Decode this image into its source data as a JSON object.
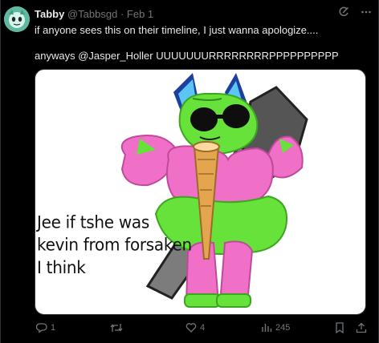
{
  "post": {
    "display_name": "Tabby",
    "handle": "@Tabbsgd",
    "separator": "·",
    "date": "Feb 1",
    "text_line1": "if anyone sees this on their timeline, I just wanna apologize....",
    "text_line2": "anyways @Jasper_Holler UUUUUUURRRRRRRRPPPPPPPPPP"
  },
  "media": {
    "caption_lines": [
      "Jee if tshe was",
      "kevin from forsaken",
      "I think"
    ]
  },
  "actions": {
    "reply_count": "1",
    "retweet_count": "",
    "like_count": "4",
    "views_count": "245"
  },
  "icons": {
    "grok": "grok-icon",
    "more": "more-icon",
    "reply": "reply-icon",
    "retweet": "retweet-icon",
    "like": "like-icon",
    "views": "views-icon",
    "bookmark": "bookmark-icon",
    "share": "share-icon"
  },
  "colors": {
    "background": "#000000",
    "text": "#e7e9ea",
    "muted": "#71767b",
    "border": "#2f3336",
    "character_green": "#66e23a",
    "character_pink": "#f070c8"
  }
}
